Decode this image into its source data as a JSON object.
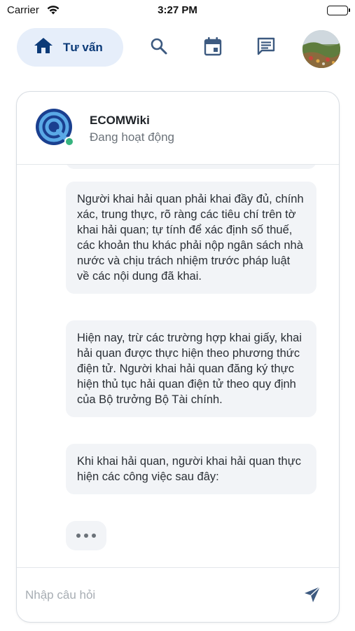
{
  "status_bar": {
    "carrier": "Carrier",
    "time": "3:27 PM"
  },
  "nav": {
    "home_label": "Tư vấn",
    "items": [
      "home-icon",
      "search-icon",
      "calendar-icon",
      "chat-icon",
      "avatar"
    ]
  },
  "chat": {
    "bot_name": "ECOMWiki",
    "bot_status": "Đang hoạt động",
    "messages": [
      "Người khai hải quan phải khai đầy đủ, chính xác, trung thực, rõ ràng các tiêu chí trên tờ khai hải quan; tự tính để xác định số thuế, các khoản thu khác phải nộp ngân sách nhà nước và chịu trách nhiệm trước pháp luật về các nội dung đã khai.",
      "Hiện nay, trừ các trường hợp khai giấy, khai hải quan được thực hiện theo phương thức điện tử. Người khai hải quan đăng ký thực hiện thủ tục hải quan điện tử theo quy định của Bộ trưởng Bộ Tài chính.",
      "Khi khai hải quan, người khai hải quan thực hiện các công việc sau đây:"
    ],
    "input_placeholder": "Nhập câu hỏi",
    "input_value": ""
  },
  "colors": {
    "accent": "#0b3a78",
    "nav_pill_bg": "#e6eefa",
    "online": "#36b37e",
    "bubble_bg": "#f2f4f7"
  }
}
